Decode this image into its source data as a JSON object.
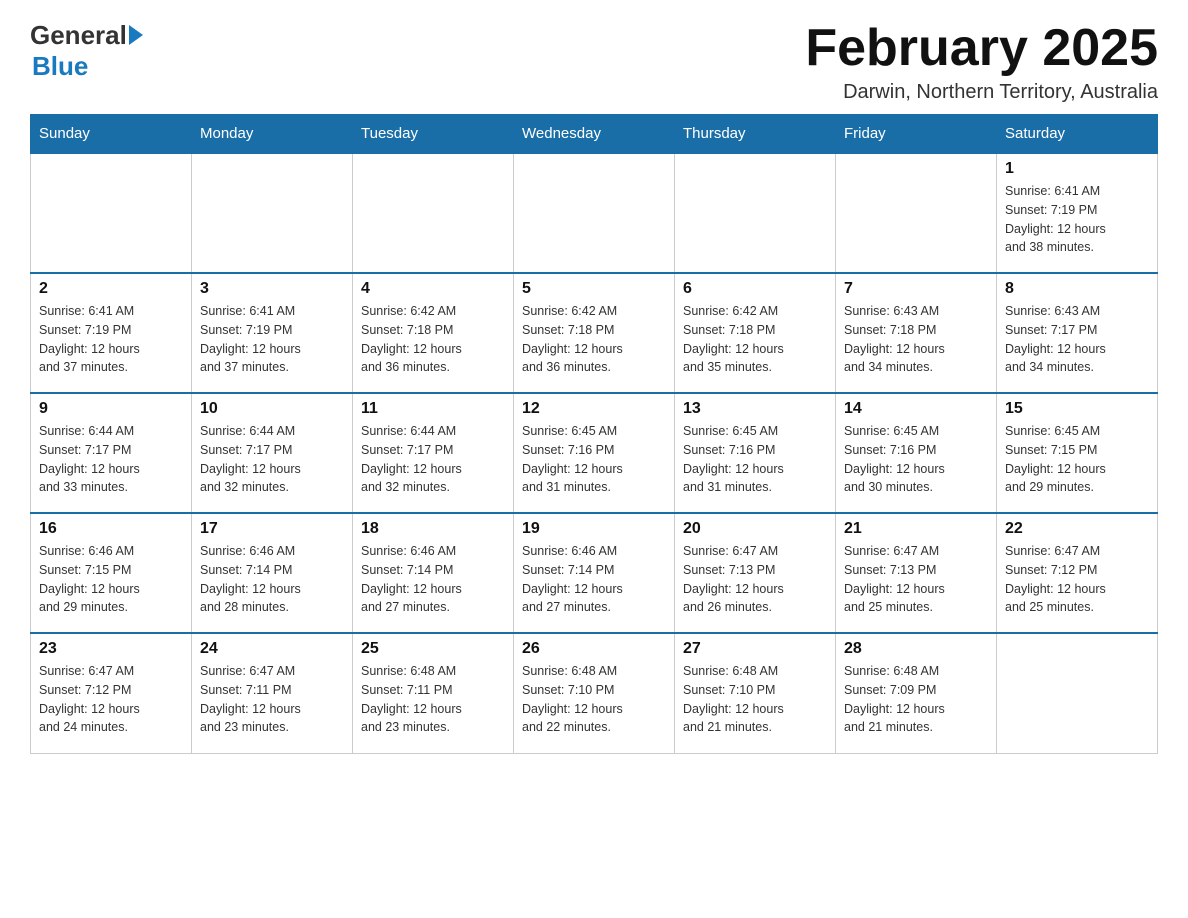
{
  "header": {
    "logo_general": "General",
    "logo_blue": "Blue",
    "month_title": "February 2025",
    "location": "Darwin, Northern Territory, Australia"
  },
  "weekdays": [
    "Sunday",
    "Monday",
    "Tuesday",
    "Wednesday",
    "Thursday",
    "Friday",
    "Saturday"
  ],
  "weeks": [
    [
      {
        "day": "",
        "info": ""
      },
      {
        "day": "",
        "info": ""
      },
      {
        "day": "",
        "info": ""
      },
      {
        "day": "",
        "info": ""
      },
      {
        "day": "",
        "info": ""
      },
      {
        "day": "",
        "info": ""
      },
      {
        "day": "1",
        "info": "Sunrise: 6:41 AM\nSunset: 7:19 PM\nDaylight: 12 hours\nand 38 minutes."
      }
    ],
    [
      {
        "day": "2",
        "info": "Sunrise: 6:41 AM\nSunset: 7:19 PM\nDaylight: 12 hours\nand 37 minutes."
      },
      {
        "day": "3",
        "info": "Sunrise: 6:41 AM\nSunset: 7:19 PM\nDaylight: 12 hours\nand 37 minutes."
      },
      {
        "day": "4",
        "info": "Sunrise: 6:42 AM\nSunset: 7:18 PM\nDaylight: 12 hours\nand 36 minutes."
      },
      {
        "day": "5",
        "info": "Sunrise: 6:42 AM\nSunset: 7:18 PM\nDaylight: 12 hours\nand 36 minutes."
      },
      {
        "day": "6",
        "info": "Sunrise: 6:42 AM\nSunset: 7:18 PM\nDaylight: 12 hours\nand 35 minutes."
      },
      {
        "day": "7",
        "info": "Sunrise: 6:43 AM\nSunset: 7:18 PM\nDaylight: 12 hours\nand 34 minutes."
      },
      {
        "day": "8",
        "info": "Sunrise: 6:43 AM\nSunset: 7:17 PM\nDaylight: 12 hours\nand 34 minutes."
      }
    ],
    [
      {
        "day": "9",
        "info": "Sunrise: 6:44 AM\nSunset: 7:17 PM\nDaylight: 12 hours\nand 33 minutes."
      },
      {
        "day": "10",
        "info": "Sunrise: 6:44 AM\nSunset: 7:17 PM\nDaylight: 12 hours\nand 32 minutes."
      },
      {
        "day": "11",
        "info": "Sunrise: 6:44 AM\nSunset: 7:17 PM\nDaylight: 12 hours\nand 32 minutes."
      },
      {
        "day": "12",
        "info": "Sunrise: 6:45 AM\nSunset: 7:16 PM\nDaylight: 12 hours\nand 31 minutes."
      },
      {
        "day": "13",
        "info": "Sunrise: 6:45 AM\nSunset: 7:16 PM\nDaylight: 12 hours\nand 31 minutes."
      },
      {
        "day": "14",
        "info": "Sunrise: 6:45 AM\nSunset: 7:16 PM\nDaylight: 12 hours\nand 30 minutes."
      },
      {
        "day": "15",
        "info": "Sunrise: 6:45 AM\nSunset: 7:15 PM\nDaylight: 12 hours\nand 29 minutes."
      }
    ],
    [
      {
        "day": "16",
        "info": "Sunrise: 6:46 AM\nSunset: 7:15 PM\nDaylight: 12 hours\nand 29 minutes."
      },
      {
        "day": "17",
        "info": "Sunrise: 6:46 AM\nSunset: 7:14 PM\nDaylight: 12 hours\nand 28 minutes."
      },
      {
        "day": "18",
        "info": "Sunrise: 6:46 AM\nSunset: 7:14 PM\nDaylight: 12 hours\nand 27 minutes."
      },
      {
        "day": "19",
        "info": "Sunrise: 6:46 AM\nSunset: 7:14 PM\nDaylight: 12 hours\nand 27 minutes."
      },
      {
        "day": "20",
        "info": "Sunrise: 6:47 AM\nSunset: 7:13 PM\nDaylight: 12 hours\nand 26 minutes."
      },
      {
        "day": "21",
        "info": "Sunrise: 6:47 AM\nSunset: 7:13 PM\nDaylight: 12 hours\nand 25 minutes."
      },
      {
        "day": "22",
        "info": "Sunrise: 6:47 AM\nSunset: 7:12 PM\nDaylight: 12 hours\nand 25 minutes."
      }
    ],
    [
      {
        "day": "23",
        "info": "Sunrise: 6:47 AM\nSunset: 7:12 PM\nDaylight: 12 hours\nand 24 minutes."
      },
      {
        "day": "24",
        "info": "Sunrise: 6:47 AM\nSunset: 7:11 PM\nDaylight: 12 hours\nand 23 minutes."
      },
      {
        "day": "25",
        "info": "Sunrise: 6:48 AM\nSunset: 7:11 PM\nDaylight: 12 hours\nand 23 minutes."
      },
      {
        "day": "26",
        "info": "Sunrise: 6:48 AM\nSunset: 7:10 PM\nDaylight: 12 hours\nand 22 minutes."
      },
      {
        "day": "27",
        "info": "Sunrise: 6:48 AM\nSunset: 7:10 PM\nDaylight: 12 hours\nand 21 minutes."
      },
      {
        "day": "28",
        "info": "Sunrise: 6:48 AM\nSunset: 7:09 PM\nDaylight: 12 hours\nand 21 minutes."
      },
      {
        "day": "",
        "info": ""
      }
    ]
  ]
}
